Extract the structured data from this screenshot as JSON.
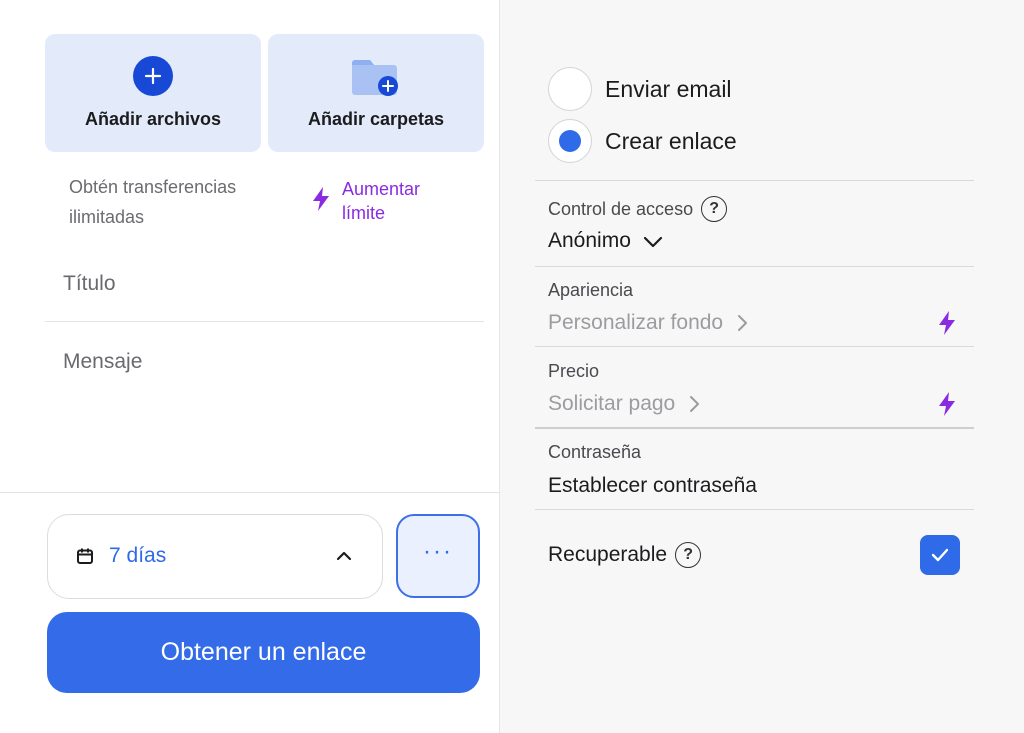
{
  "left": {
    "add_files_label": "Añadir archivos",
    "add_folders_label": "Añadir carpetas",
    "promo_text": "Obtén transferencias ilimitadas",
    "promo_link": "Aumentar límite",
    "title_placeholder": "Título",
    "message_placeholder": "Mensaje",
    "expiry_label": "7 días",
    "more_label": "···",
    "primary_button": "Obtener un enlace"
  },
  "right": {
    "options": [
      {
        "label": "Enviar email",
        "selected": false
      },
      {
        "label": "Crear enlace",
        "selected": true
      }
    ],
    "access": {
      "label": "Control de acceso",
      "value": "Anónimo"
    },
    "appearance": {
      "label": "Apariencia",
      "value": "Personalizar fondo"
    },
    "price": {
      "label": "Precio",
      "value": "Solicitar pago"
    },
    "password": {
      "label": "Contraseña",
      "value": "Establecer contraseña"
    },
    "recoverable": {
      "label": "Recuperable",
      "checked": true
    }
  },
  "colors": {
    "accent": "#336be8",
    "tile_bg": "#e3ebfb",
    "upgrade_purple": "#8a2be2"
  },
  "icons": [
    "plus-circle-icon",
    "folder-plus-icon",
    "bolt-icon",
    "calendar-icon",
    "chevron-up-icon",
    "chevron-down-icon",
    "chevron-right-icon",
    "help-icon",
    "check-icon"
  ]
}
